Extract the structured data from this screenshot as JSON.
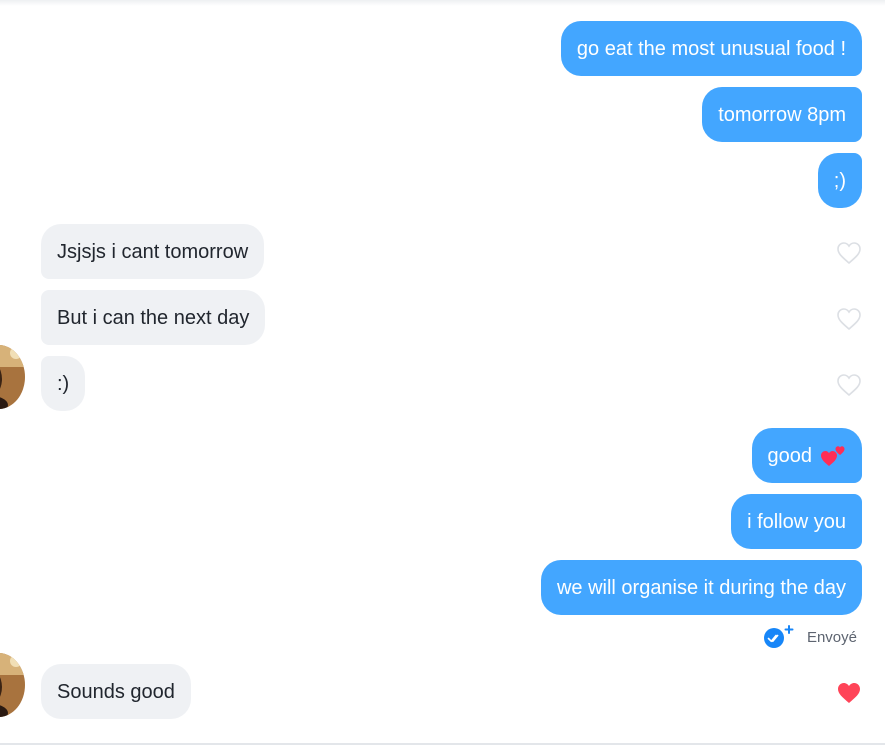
{
  "messages": {
    "m1": "go eat the most unusual food !",
    "m2": "tomorrow 8pm",
    "m3": ";)",
    "m4": "Jsjsjs i cant tomorrow",
    "m5": "But i can the next day",
    "m6": ":)",
    "m7": "good",
    "m8": "i follow you",
    "m9": "we will organise it during the day",
    "m10": "Sounds good"
  },
  "status": {
    "label": "Envoyé"
  },
  "icons": {
    "like_outline": "heart-outline-icon",
    "like_filled": "heart-filled-icon",
    "emoji": "two-hearts-emoji",
    "sent_check": "double-check-icon"
  },
  "colors": {
    "sent_bubble": "#43a6ff",
    "received_bubble": "#eff1f4",
    "like": "#ff4458"
  }
}
